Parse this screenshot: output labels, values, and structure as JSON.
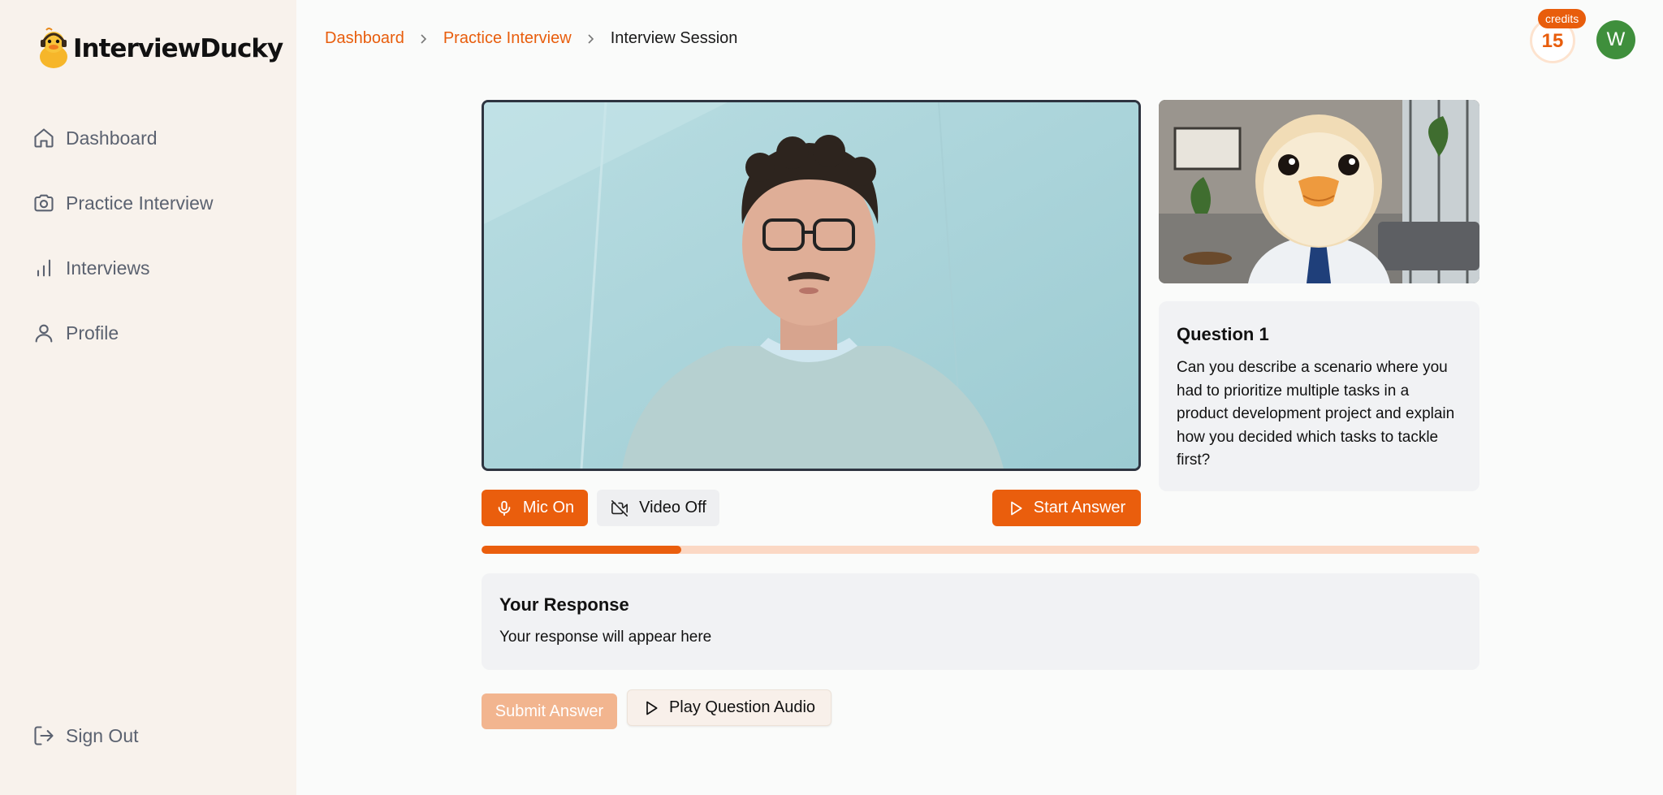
{
  "app": {
    "logo_text": "InterviewDucky"
  },
  "sidebar": {
    "items": [
      {
        "label": "Dashboard",
        "icon": "home-icon"
      },
      {
        "label": "Practice Interview",
        "icon": "camera-icon"
      },
      {
        "label": "Interviews",
        "icon": "bar-chart-icon"
      },
      {
        "label": "Profile",
        "icon": "user-icon"
      }
    ],
    "signout_label": "Sign Out"
  },
  "breadcrumb": {
    "items": [
      "Dashboard",
      "Practice Interview"
    ],
    "current": "Interview Session"
  },
  "header": {
    "credits_label": "credits",
    "credits_count": "15",
    "avatar_initial": "W"
  },
  "question": {
    "title": "Question 1",
    "text": "Can you describe a scenario where you had to prioritize multiple tasks in a product development project and explain how you decided which tasks to tackle first?"
  },
  "controls": {
    "mic_label": "Mic On",
    "video_label": "Video Off",
    "start_label": "Start Answer"
  },
  "progress": {
    "fraction": 0.2
  },
  "response": {
    "title": "Your Response",
    "placeholder": "Your response will appear here"
  },
  "actions": {
    "submit_label": "Submit Answer",
    "play_label": "Play Question Audio"
  },
  "colors": {
    "accent": "#ea5e0d",
    "sidebar_bg": "#f8f2ec",
    "avatar_bg": "#3f8f3c"
  }
}
